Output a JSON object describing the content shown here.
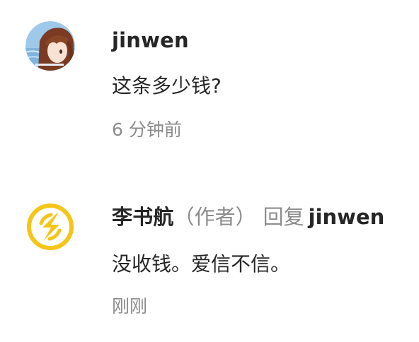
{
  "comments": [
    {
      "username": "jinwen",
      "content": "这条多少钱?",
      "time": "6 分钟前",
      "avatar_icon": "anime-girl-avatar"
    },
    {
      "username": "李书航",
      "role": "（作者）",
      "reply_word": "回复",
      "reply_target": "jinwen",
      "content": "没收钱。爱信不信。",
      "time": "刚刚",
      "avatar_icon": "lightning-logo-avatar",
      "avatar_color": "#f5c518"
    }
  ]
}
